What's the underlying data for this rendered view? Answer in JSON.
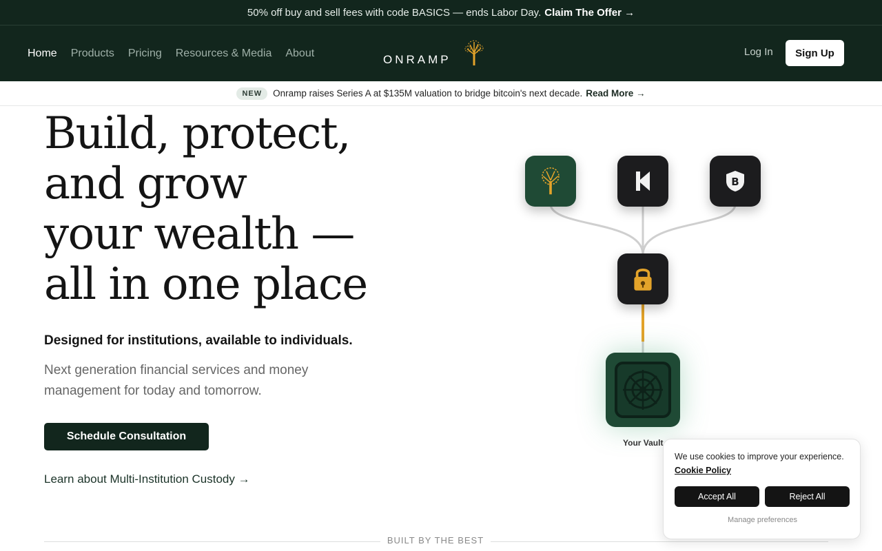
{
  "promo": {
    "text": "50% off buy and sell fees with code BASICS — ends Labor Day.",
    "link": "Claim The Offer →"
  },
  "nav": {
    "items": [
      {
        "label": "Home"
      },
      {
        "label": "Products"
      },
      {
        "label": "Pricing"
      },
      {
        "label": "Resources & Media"
      },
      {
        "label": "About"
      }
    ],
    "logo_text": "ONRAMP",
    "login": "Log In",
    "signup": "Sign Up"
  },
  "news": {
    "badge": "NEW",
    "text": "Onramp raises Series A at $135M valuation to bridge bitcoin's next decade.",
    "link": "Read More →"
  },
  "hero": {
    "title_lines": [
      "Build, protect,",
      "and grow",
      "your wealth —",
      "all in one place"
    ],
    "lead": "Designed for institutions, available to individuals.",
    "sub": "Next generation financial services and money management for today and tomorrow.",
    "cta": "Schedule Consultation",
    "learn": "Learn about Multi-Institution Custody →"
  },
  "diagram": {
    "vault_label": "Your Vault",
    "icons": [
      "tree-icon",
      "kraken-icon",
      "bitcoin-shield-icon",
      "lock-icon",
      "vault-icon"
    ],
    "colors": {
      "tile_dark": "#1c1c1e",
      "tile_green": "#1f4a35",
      "accent_gold": "#e3a32a",
      "connector": "#cfcfcf"
    }
  },
  "section": {
    "built_by": "BUILT BY THE BEST"
  },
  "cookie": {
    "message": "We use cookies to improve your experience.",
    "policy": "Cookie Policy",
    "accept": "Accept All",
    "reject": "Reject All",
    "manage": "Manage preferences"
  },
  "colors": {
    "brand_dark": "#12261d",
    "page_bg": "#ffffff"
  }
}
